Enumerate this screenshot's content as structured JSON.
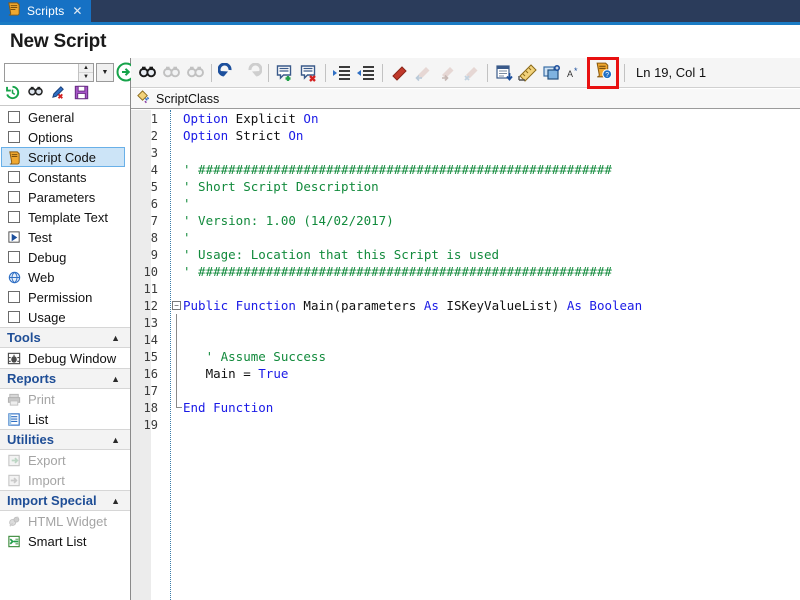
{
  "tab": {
    "label": "Scripts",
    "close": "✕",
    "icon": "script-icon"
  },
  "page": {
    "title": "New Script"
  },
  "leftpanel": {
    "combo": {
      "value": "",
      "placeholder": ""
    },
    "spin_up": "▲",
    "spin_down": "▼",
    "dropdown_arrow": "▼",
    "quick_icons": [
      {
        "name": "history-icon",
        "label": "History"
      },
      {
        "name": "find-icon",
        "label": "Find"
      },
      {
        "name": "edit-delete-icon",
        "label": "Clear"
      },
      {
        "name": "save-icon",
        "label": "Save"
      }
    ],
    "items": [
      {
        "label": "General",
        "icon": "checkbox-icon",
        "selected": false,
        "disabled": false
      },
      {
        "label": "Options",
        "icon": "checkbox-icon",
        "selected": false,
        "disabled": false
      },
      {
        "label": "Script Code",
        "icon": "script-code-icon",
        "selected": true,
        "disabled": false
      },
      {
        "label": "Constants",
        "icon": "checkbox-icon",
        "selected": false,
        "disabled": false
      },
      {
        "label": "Parameters",
        "icon": "checkbox-icon",
        "selected": false,
        "disabled": false
      },
      {
        "label": "Template Text",
        "icon": "checkbox-icon",
        "selected": false,
        "disabled": false
      },
      {
        "label": "Test",
        "icon": "play-icon",
        "selected": false,
        "disabled": false
      },
      {
        "label": "Debug",
        "icon": "checkbox-icon",
        "selected": false,
        "disabled": false
      },
      {
        "label": "Web",
        "icon": "globe-icon",
        "selected": false,
        "disabled": false
      },
      {
        "label": "Permission",
        "icon": "checkbox-icon",
        "selected": false,
        "disabled": false
      },
      {
        "label": "Usage",
        "icon": "checkbox-icon",
        "selected": false,
        "disabled": false
      }
    ],
    "sections": [
      {
        "title": "Tools",
        "chevron": "▲",
        "items": [
          {
            "label": "Debug Window",
            "icon": "debug-window-icon",
            "disabled": false
          }
        ]
      },
      {
        "title": "Reports",
        "chevron": "▲",
        "items": [
          {
            "label": "Print",
            "icon": "printer-icon",
            "disabled": true
          },
          {
            "label": "List",
            "icon": "list-icon",
            "disabled": false
          }
        ]
      },
      {
        "title": "Utilities",
        "chevron": "▲",
        "items": [
          {
            "label": "Export",
            "icon": "export-icon",
            "disabled": true
          },
          {
            "label": "Import",
            "icon": "import-icon",
            "disabled": true
          }
        ]
      },
      {
        "title": "Import Special",
        "chevron": "▲",
        "items": [
          {
            "label": "HTML Widget",
            "icon": "html-widget-icon",
            "disabled": true
          },
          {
            "label": "Smart List",
            "icon": "smart-list-icon",
            "disabled": false
          }
        ]
      }
    ]
  },
  "toolbar": {
    "buttons": [
      {
        "name": "find-icon",
        "enabled": true
      },
      {
        "name": "find-previous-icon",
        "enabled": false
      },
      {
        "name": "find-next-icon",
        "enabled": false
      },
      {
        "name": "undo-icon",
        "enabled": true
      },
      {
        "name": "redo-icon",
        "enabled": false
      },
      {
        "name": "comment-icon",
        "enabled": true
      },
      {
        "name": "uncomment-icon",
        "enabled": true
      },
      {
        "name": "indent-icon",
        "enabled": true
      },
      {
        "name": "outdent-icon",
        "enabled": true
      },
      {
        "name": "toggle-bookmark-icon",
        "enabled": true
      },
      {
        "name": "previous-bookmark-icon",
        "enabled": false
      },
      {
        "name": "next-bookmark-icon",
        "enabled": false
      },
      {
        "name": "clear-bookmarks-icon",
        "enabled": false
      },
      {
        "name": "insert-snippet-icon",
        "enabled": true
      },
      {
        "name": "measure-icon",
        "enabled": true
      },
      {
        "name": "object-browser-icon",
        "enabled": true
      },
      {
        "name": "autocomplete-icon",
        "enabled": true
      }
    ],
    "highlighted_button": {
      "name": "script-help-icon",
      "highlight_color": "#e81010"
    },
    "status": "Ln 19, Col 1"
  },
  "classbar": {
    "icon": "class-icon",
    "name": "ScriptClass"
  },
  "code": {
    "hash_rule": "' ########################################################",
    "lines": [
      {
        "n": 1,
        "fold": "",
        "segments": [
          {
            "t": "Option",
            "c": "kw"
          },
          {
            "t": " Explicit ",
            "c": "id"
          },
          {
            "t": "On",
            "c": "kw"
          }
        ]
      },
      {
        "n": 2,
        "fold": "",
        "segments": [
          {
            "t": "Option",
            "c": "kw"
          },
          {
            "t": " Strict ",
            "c": "id"
          },
          {
            "t": "On",
            "c": "kw"
          }
        ]
      },
      {
        "n": 3,
        "fold": "",
        "segments": []
      },
      {
        "n": 4,
        "fold": "",
        "segments": [
          {
            "t": "' #######################################################",
            "c": "cm"
          }
        ]
      },
      {
        "n": 5,
        "fold": "",
        "segments": [
          {
            "t": "' Short Script Description",
            "c": "cm"
          }
        ]
      },
      {
        "n": 6,
        "fold": "",
        "segments": [
          {
            "t": "'",
            "c": "cm"
          }
        ]
      },
      {
        "n": 7,
        "fold": "",
        "segments": [
          {
            "t": "' Version: 1.00 (14/02/2017)",
            "c": "cm"
          }
        ]
      },
      {
        "n": 8,
        "fold": "",
        "segments": [
          {
            "t": "'",
            "c": "cm"
          }
        ]
      },
      {
        "n": 9,
        "fold": "",
        "segments": [
          {
            "t": "' Usage: Location that this Script is used",
            "c": "cm"
          }
        ]
      },
      {
        "n": 10,
        "fold": "",
        "segments": [
          {
            "t": "' #######################################################",
            "c": "cm"
          }
        ]
      },
      {
        "n": 11,
        "fold": "",
        "segments": []
      },
      {
        "n": 12,
        "fold": "open",
        "segments": [
          {
            "t": "Public Function ",
            "c": "kw"
          },
          {
            "t": "Main(parameters ",
            "c": "id"
          },
          {
            "t": "As",
            "c": "kw"
          },
          {
            "t": " ISKeyValueList) ",
            "c": "id"
          },
          {
            "t": "As Boolean",
            "c": "kw"
          }
        ]
      },
      {
        "n": 13,
        "fold": "bar",
        "segments": []
      },
      {
        "n": 14,
        "fold": "bar",
        "segments": []
      },
      {
        "n": 15,
        "fold": "bar",
        "segments": [
          {
            "t": "   ' Assume Success",
            "c": "cm"
          }
        ]
      },
      {
        "n": 16,
        "fold": "bar",
        "segments": [
          {
            "t": "   Main = ",
            "c": "id"
          },
          {
            "t": "True",
            "c": "kw"
          }
        ]
      },
      {
        "n": 17,
        "fold": "bar",
        "segments": []
      },
      {
        "n": 18,
        "fold": "close",
        "segments": [
          {
            "t": "End Function",
            "c": "kw"
          }
        ]
      },
      {
        "n": 19,
        "fold": "",
        "segments": []
      }
    ]
  },
  "colors": {
    "tab_active": "#1671c4",
    "titlebar": "#2b3c5b",
    "accent": "#1a7bc4",
    "selection": "#cce4f7",
    "keyword": "#1a1ae6",
    "comment": "#128a3c",
    "section_header": "#1f4e96"
  }
}
